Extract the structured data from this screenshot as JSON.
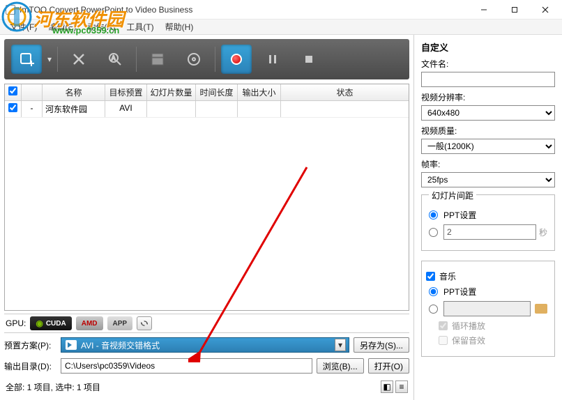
{
  "window": {
    "title": "ImTOO Convert PowerPoint to Video Business"
  },
  "menu": {
    "file": "文件(F)",
    "edit": "编辑(E)",
    "action": "动作(A)",
    "tool": "工具(T)",
    "help": "帮助(H)"
  },
  "watermark": {
    "text": "河东软件园",
    "url": "www.pc0359.cn"
  },
  "table": {
    "headers": {
      "name": "名称",
      "preset": "目标预置",
      "slides": "幻灯片数量",
      "duration": "时间长度",
      "size": "输出大小",
      "status": "状态"
    },
    "rows": [
      {
        "idx": "-",
        "name": "河东软件园",
        "preset": "AVI",
        "slides": "",
        "duration": "",
        "size": "",
        "status": ""
      }
    ]
  },
  "gpu": {
    "label": "GPU:",
    "cuda": "CUDA",
    "amd": "AMD",
    "app": "APP"
  },
  "bottom": {
    "preset_label": "预置方案(P):",
    "preset_value": "AVI - 音视频交错格式",
    "saveas": "另存为(S)...",
    "output_label": "输出目录(D):",
    "output_value": "C:\\Users\\pc0359\\Videos",
    "browse": "浏览(B)...",
    "open": "打开(O)",
    "status": "全部: 1 项目, 选中: 1 项目"
  },
  "right": {
    "title": "自定义",
    "filename_label": "文件名:",
    "filename_value": "",
    "resolution_label": "视频分辨率:",
    "resolution_value": "640x480",
    "quality_label": "视频质量:",
    "quality_value": "一般(1200K)",
    "fps_label": "帧率:",
    "fps_value": "25fps",
    "interval_legend": "幻灯片间距",
    "ppt_setting": "PPT设置",
    "seconds_unit": "秒",
    "seconds_value": "2",
    "music_label": "音乐",
    "loop_label": "循环播放",
    "keep_sfx_label": "保留音效"
  }
}
